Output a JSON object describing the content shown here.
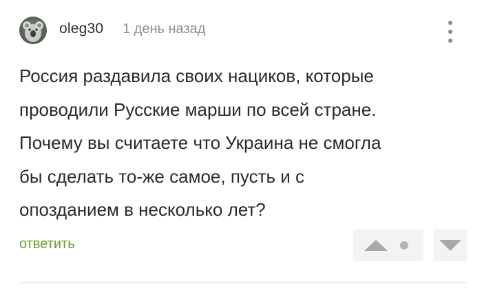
{
  "comment": {
    "author": "oleg30",
    "time": "1 день назад",
    "text_lines": [
      "Россия раздавила своих нациков, которые",
      "проводили Русские марши по всей стране.",
      "Почему вы считаете что Украина не смогла",
      "бы сделать то-же самое, пусть и с",
      "опозданием в несколько лет?"
    ],
    "reply_label": "ответить"
  },
  "icons": {
    "menu": "more-vertical-icon",
    "vote_up": "triangle-up-icon",
    "vote_down": "triangle-down-icon",
    "rating": "dot-icon"
  },
  "colors": {
    "reply": "#6c9b2e",
    "text": "#2a2a2a",
    "meta": "#8e8e8e",
    "vote_bg": "#f3f3f3",
    "vote_icon": "#a9a9a9"
  }
}
